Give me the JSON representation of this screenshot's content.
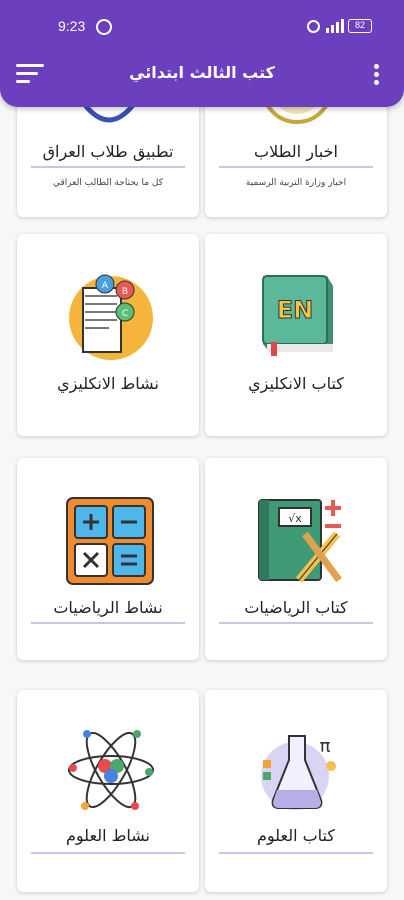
{
  "status_bar": {
    "time": "9:23",
    "battery": "82"
  },
  "app_bar": {
    "title": "كتب الثالث ابتدائي"
  },
  "top_cards": [
    {
      "label": "اخبار الطلاب",
      "subtitle": "اخبار وزارة التربية الرسمية"
    },
    {
      "label": "تطبيق طلاب العراق",
      "subtitle": "كل ما يحتاجة الطالب العراقي"
    }
  ],
  "cards": [
    {
      "label": "كتاب الانكليزي"
    },
    {
      "label": "نشاط الانكليزي"
    },
    {
      "label": "كتاب الرياضيات"
    },
    {
      "label": "نشاط الرياضيات"
    },
    {
      "label": "كتاب العلوم"
    },
    {
      "label": "نشاط العلوم"
    }
  ],
  "icons": {
    "english_book_text": "EN",
    "pi_symbol": "π",
    "sqrt_symbol": "√x"
  },
  "colors": {
    "primary": "#6c3fbf",
    "card_line": "#c9c5e6"
  }
}
